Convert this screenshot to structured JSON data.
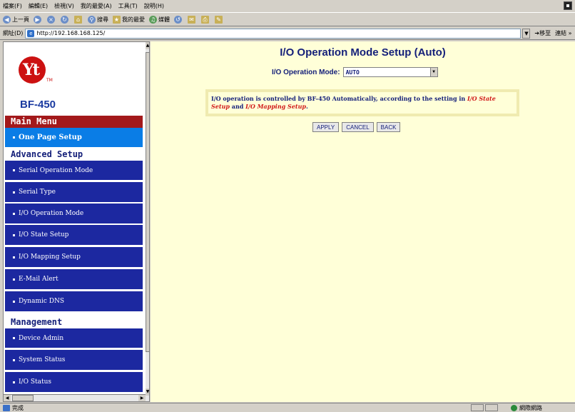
{
  "browser": {
    "menu": [
      "檔案(F)",
      "編輯(E)",
      "檢視(V)",
      "我的最愛(A)",
      "工具(T)",
      "說明(H)"
    ],
    "toolbar": {
      "back": "上一頁",
      "search": "搜尋",
      "favorites": "我的最愛",
      "media": "媒體"
    },
    "address": {
      "label": "網址(D)",
      "url": "http://192.168.168.125/",
      "go": "移至",
      "links": "連結"
    },
    "status": {
      "text": "完成",
      "zone": "網際網路"
    }
  },
  "sidebar": {
    "logo_text": "Yt",
    "logo_tm": "TM",
    "model": "BF-450",
    "main_menu_title": "Main Menu",
    "main_items": [
      {
        "label": "One Page Setup"
      }
    ],
    "advanced_title": "Advanced Setup",
    "advanced_items": [
      {
        "label": "Serial Operation Mode"
      },
      {
        "label": "Serial Type"
      },
      {
        "label": "I/O Operation Mode"
      },
      {
        "label": "I/O State Setup"
      },
      {
        "label": "I/O Mapping Setup"
      },
      {
        "label": "E-Mail Alert"
      },
      {
        "label": "Dynamic DNS"
      }
    ],
    "management_title": "Management",
    "management_items": [
      {
        "label": "Device Admin"
      },
      {
        "label": "System Status"
      },
      {
        "label": "I/O Status"
      }
    ]
  },
  "content": {
    "title": "I/O Operation Mode Setup (Auto)",
    "mode_label": "I/O Operation Mode:",
    "mode_value": "AUTO",
    "info": {
      "text1": "I/O operation is controlled by BF-450 Automatically, according to the setting in ",
      "link1": "I/O State Setup",
      "text2": " and ",
      "link2": "I/O Mapping Setup",
      "text3": "."
    },
    "buttons": {
      "apply": "APPLY",
      "cancel": "CANCEL",
      "back": "BACK"
    }
  }
}
